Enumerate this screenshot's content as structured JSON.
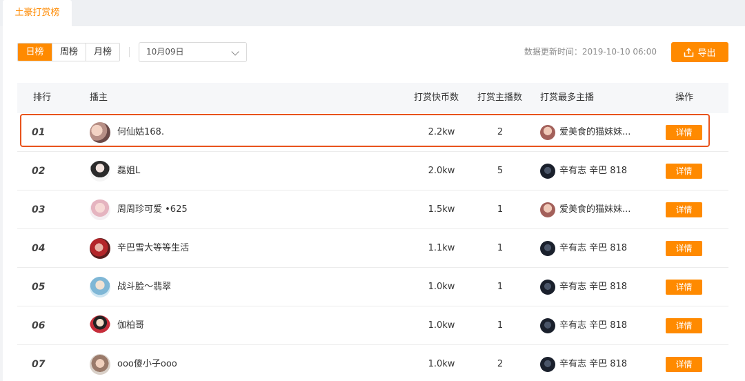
{
  "tabs": {
    "active_label": "土豪打赏榜"
  },
  "toolbar": {
    "periods": [
      {
        "label": "日榜",
        "active": true
      },
      {
        "label": "周榜",
        "active": false
      },
      {
        "label": "月榜",
        "active": false
      }
    ],
    "date_value": "10月09日",
    "update_time": "数据更新时间：2019-10-10 06:00",
    "export_label": "导出"
  },
  "table": {
    "headers": {
      "rank": "排行",
      "host": "播主",
      "coins": "打赏快币数",
      "host_count": "打赏主播数",
      "top_host": "打赏最多主播",
      "action": "操作"
    },
    "rows": [
      {
        "rank": "01",
        "host": "何仙姑168.",
        "coins": "2.2kw",
        "count": "2",
        "top": "爱美食的猫妹妹...",
        "action": "详情"
      },
      {
        "rank": "02",
        "host": "磊姐L",
        "coins": "2.0kw",
        "count": "5",
        "top": "辛有志 辛巴 818",
        "action": "详情"
      },
      {
        "rank": "03",
        "host": "周周珍可爱 •625",
        "coins": "1.5kw",
        "count": "1",
        "top": "爱美食的猫妹妹...",
        "action": "详情"
      },
      {
        "rank": "04",
        "host": "辛巴雪大等等生活",
        "coins": "1.1kw",
        "count": "1",
        "top": "辛有志 辛巴 818",
        "action": "详情"
      },
      {
        "rank": "05",
        "host": "战斗脸～翡翠",
        "coins": "1.0kw",
        "count": "1",
        "top": "辛有志 辛巴 818",
        "action": "详情"
      },
      {
        "rank": "06",
        "host": "伽柏哥",
        "coins": "1.0kw",
        "count": "1",
        "top": "辛有志 辛巴 818",
        "action": "详情"
      },
      {
        "rank": "07",
        "host": "ooo傻小子ooo",
        "coins": "1.0kw",
        "count": "2",
        "top": "辛有志 辛巴 818",
        "action": "详情"
      }
    ]
  },
  "colors": {
    "accent": "#ff8a00",
    "highlight": "#e8531c"
  }
}
